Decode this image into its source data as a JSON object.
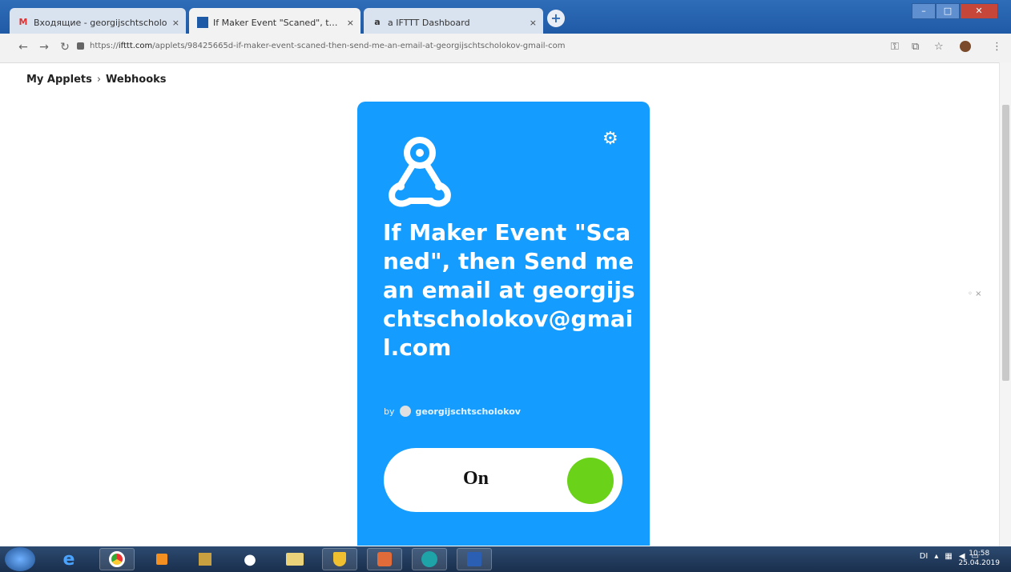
{
  "browser": {
    "tabs": [
      {
        "title": "Входящие - georgijschtscholo",
        "favicon": "gmail-icon",
        "active": false
      },
      {
        "title": "If Maker Event \"Scaned\", then Se",
        "favicon": "ifttt-icon",
        "active": true
      },
      {
        "title": "a IFTTT Dashboard",
        "favicon": "ifttt-a-icon",
        "active": false
      }
    ],
    "tab_close": "×",
    "new_tab": "+",
    "url_prefix": "https://",
    "url_domain": "ifttt.com",
    "url_path": "/applets/98425665d-if-maker-event-scaned-then-send-me-an-email-at-georgijschtscholokov-gmail-com"
  },
  "breadcrumb": {
    "root": "My Applets",
    "separator": "›",
    "current": "Webhooks"
  },
  "applet": {
    "title": "If Maker Event \"Scaned\", then Send me an email at georgijschtscholokov@gmail.com",
    "by_label": "by",
    "author": "georgijschtscholokov",
    "toggle_label": "On",
    "accent": "#149cff",
    "toggle_color": "#6bd21a"
  },
  "taskbar": {
    "clock_time": "10:58",
    "clock_date": "25.04.2019",
    "tray_lang": "DI"
  }
}
